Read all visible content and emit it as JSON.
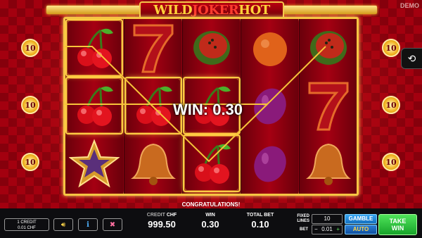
{
  "header": {
    "demo_label": "DEMO",
    "logo_wild": "WILD",
    "logo_joker": "JOKER",
    "logo_hot": "HOT"
  },
  "line_indicators": {
    "left": [
      "10",
      "10",
      "10"
    ],
    "right": [
      "10",
      "10",
      "10"
    ]
  },
  "reels": [
    [
      "cherry",
      "cherry",
      "star"
    ],
    [
      "seven",
      "cherry",
      "bell"
    ],
    [
      "watermelon",
      "cherry",
      "cherry"
    ],
    [
      "orange",
      "plum",
      "plum"
    ],
    [
      "watermelon",
      "seven",
      "bell"
    ]
  ],
  "win_overlay": "WIN: 0.30",
  "status": {
    "congrats": "CONGRATULATIONS!"
  },
  "bottom_bar": {
    "credit_small_line1": "1 CREDIT",
    "credit_small_line2": "0.01 CHF",
    "credit_label": "CREDIT",
    "credit_currency": "CHF",
    "credit_value": "999.50",
    "win_label": "WIN",
    "win_value": "0.30",
    "total_bet_label": "TOTAL BET",
    "total_bet_value": "0.10",
    "fixed_lines_label_1": "FIXED",
    "fixed_lines_label_2": "LINES",
    "fixed_lines_value": "10",
    "bet_label": "BET",
    "bet_minus": "−",
    "bet_value": "0.01",
    "bet_plus": "+",
    "gamble_label": "GAMBLE",
    "auto_label": "AUTO",
    "take_win_1": "TAKE",
    "take_win_2": "WIN"
  },
  "colors": {
    "frame_gold": "#f6c543",
    "background_red": "#a3000f",
    "take_win_green": "#17a32a",
    "gamble_blue": "#136fc0"
  }
}
